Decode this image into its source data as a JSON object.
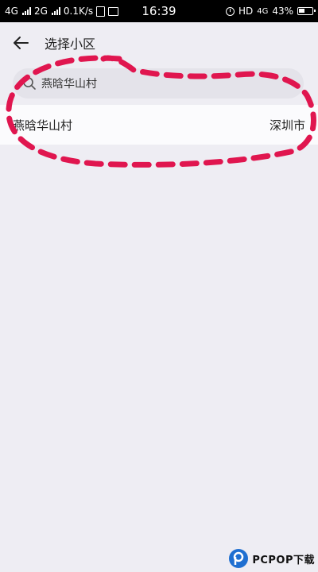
{
  "status_bar": {
    "sim1": "4G",
    "sim2": "2G",
    "net_speed": "0.1K/s",
    "time": "16:39",
    "hd": "HD",
    "net_type": "4G",
    "battery": "43%"
  },
  "header": {
    "title": "选择小区"
  },
  "search": {
    "value": "燕晗华山村"
  },
  "results": [
    {
      "name": "燕晗华山村",
      "city": "深圳市"
    }
  ],
  "colors": {
    "annotation": "#e0164f",
    "background": "#eeedf3"
  },
  "watermark": {
    "text": "PCPOP下载"
  }
}
